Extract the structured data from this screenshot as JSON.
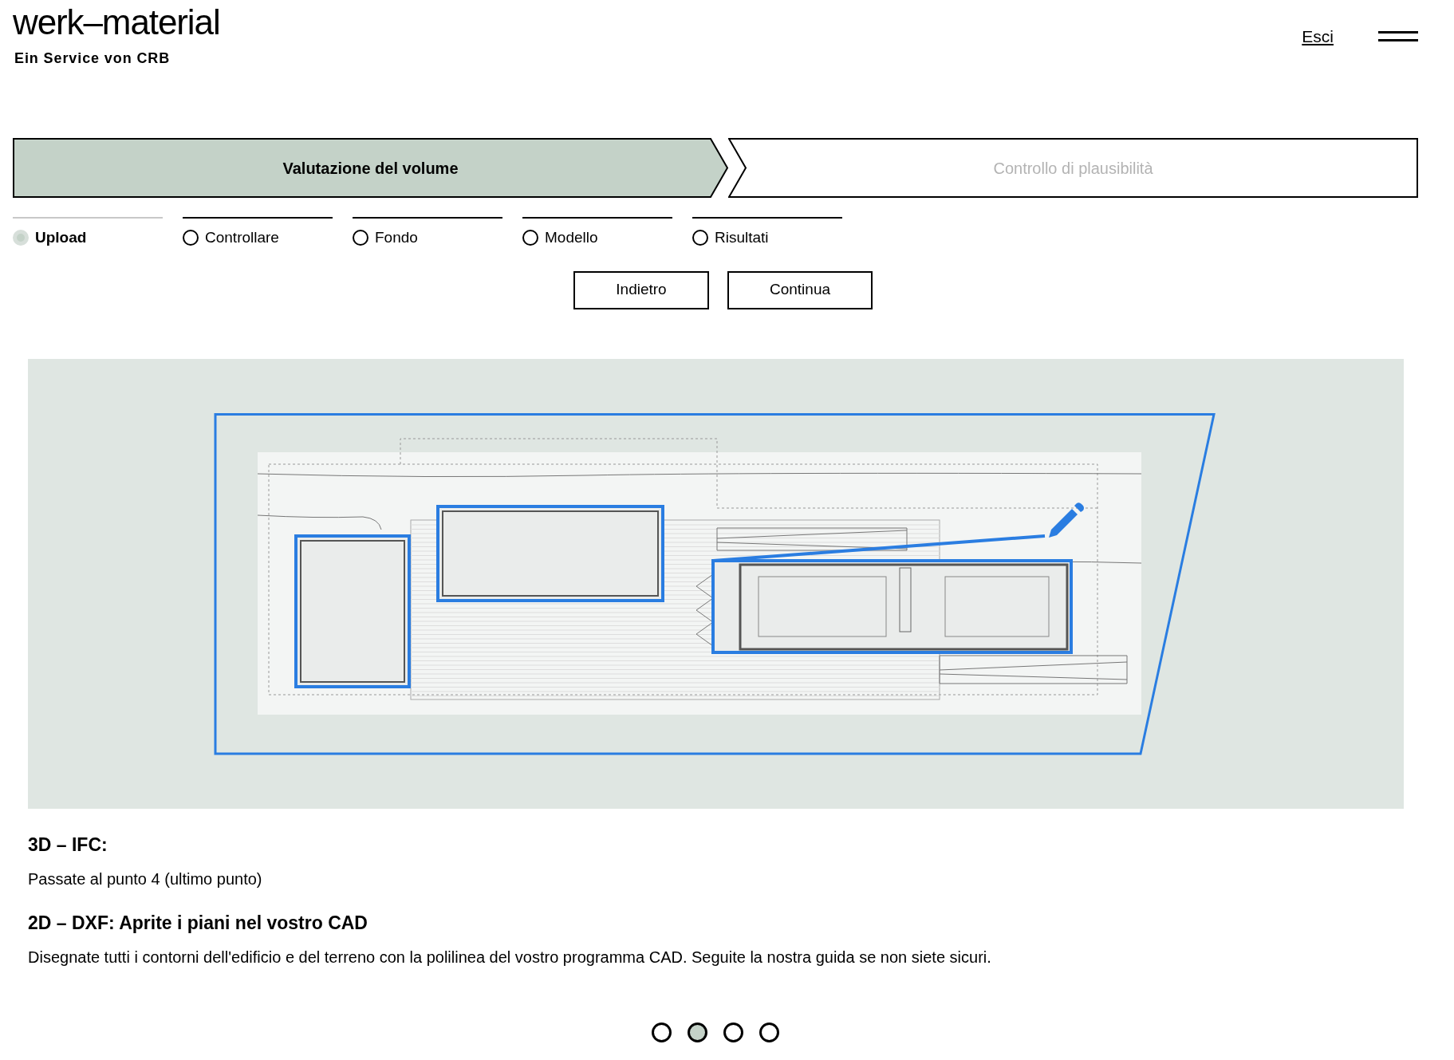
{
  "header": {
    "logo": "werk–material",
    "tagline": "Ein Service von CRB",
    "logout_link": "Esci"
  },
  "phases": [
    {
      "label": "Valutazione del volume",
      "selected": true
    },
    {
      "label": "Controllo di plausibilità",
      "selected": false
    }
  ],
  "steps": [
    {
      "label": "Upload",
      "selected": true
    },
    {
      "label": "Controllare",
      "selected": false
    },
    {
      "label": "Fondo",
      "selected": false
    },
    {
      "label": "Modello",
      "selected": false
    },
    {
      "label": "Risultati",
      "selected": false
    }
  ],
  "buttons": [
    "Indietro",
    "Continua"
  ],
  "sections": [
    {
      "kind": "heading",
      "text": "3D – IFC:"
    },
    {
      "kind": "paragraph",
      "text": "Passate al punto 4 (ultimo punto)"
    },
    {
      "kind": "heading",
      "text": "2D – DXF: Aprite i piani nel vostro CAD"
    },
    {
      "kind": "paragraph",
      "text": "Disegnate tutti i contorni dell'edificio e del terreno con la polilinea del vostro programma CAD. Seguite la nostra guida se non siete sicuri."
    }
  ],
  "carousel_dots": [
    {
      "selected": false
    },
    {
      "selected": true
    },
    {
      "selected": false
    },
    {
      "selected": false
    }
  ]
}
